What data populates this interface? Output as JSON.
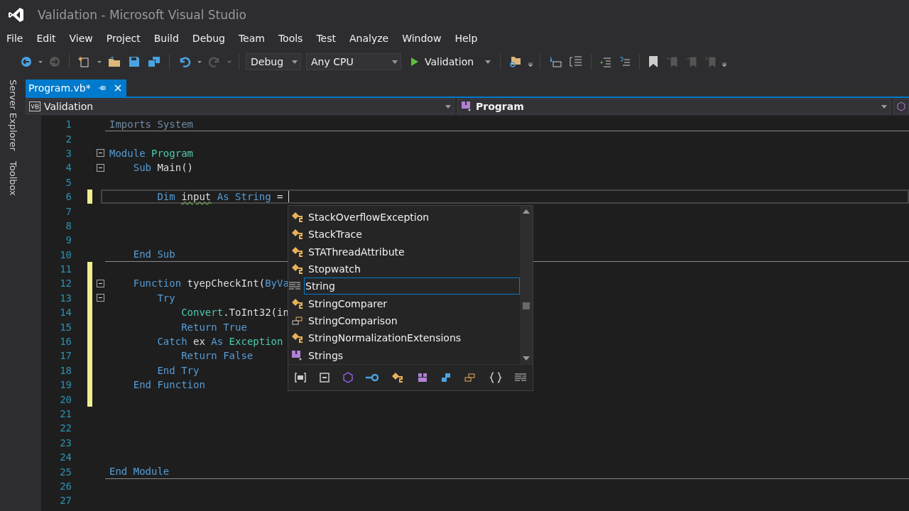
{
  "window": {
    "title": "Validation - Microsoft Visual Studio"
  },
  "menu": [
    "File",
    "Edit",
    "View",
    "Project",
    "Build",
    "Debug",
    "Team",
    "Tools",
    "Test",
    "Analyze",
    "Window",
    "Help"
  ],
  "toolbar": {
    "configuration": "Debug",
    "platform": "Any CPU",
    "start": "Validation"
  },
  "side_tabs": [
    "Server Explorer",
    "Toolbox"
  ],
  "tabs": [
    {
      "label": "Program.vb*",
      "selected": true
    }
  ],
  "navigation": {
    "project": "Validation",
    "type": "Program"
  },
  "lines": [
    {
      "number": "1",
      "tokens": [
        {
          "t": "Imports System",
          "kind": "faded"
        }
      ],
      "separator": true
    },
    {
      "number": "2"
    },
    {
      "number": "3",
      "fold": true,
      "tokens": [
        {
          "t": "Module ",
          "kind": "kw"
        },
        {
          "t": "Program",
          "kind": "type"
        }
      ]
    },
    {
      "number": "4",
      "fold": true,
      "tokens": [
        {
          "t": "    Sub",
          "kind": "kw"
        },
        {
          "t": " Main()",
          "kind": "plain"
        }
      ]
    },
    {
      "number": "5"
    },
    {
      "number": "6",
      "changed": true,
      "current": true,
      "tokens": [
        {
          "t": "        Dim ",
          "kind": "kw"
        },
        {
          "t": "input",
          "kind": "warn"
        },
        {
          "t": " As String",
          "kind": "kw"
        },
        {
          "t": " =",
          "kind": "plain"
        }
      ]
    },
    {
      "number": "7"
    },
    {
      "number": "8"
    },
    {
      "number": "9"
    },
    {
      "number": "10",
      "separator": true,
      "tokens": [
        {
          "t": "    End Sub",
          "kind": "kw"
        }
      ]
    },
    {
      "number": "11",
      "changed": true
    },
    {
      "number": "12",
      "changed": true,
      "fold": true,
      "tokens": [
        {
          "t": "    Function",
          "kind": "kw"
        },
        {
          "t": " tyepCheckInt(",
          "kind": "plain"
        },
        {
          "t": "ByVa",
          "kind": "kw"
        }
      ]
    },
    {
      "number": "13",
      "changed": true,
      "fold": true,
      "tokens": [
        {
          "t": "        Try",
          "kind": "kw"
        }
      ]
    },
    {
      "number": "14",
      "changed": true,
      "tokens": [
        {
          "t": "            Convert",
          "kind": "type"
        },
        {
          "t": ".ToInt32(in",
          "kind": "plain"
        }
      ]
    },
    {
      "number": "15",
      "changed": true,
      "tokens": [
        {
          "t": "            Return True",
          "kind": "kw"
        }
      ]
    },
    {
      "number": "16",
      "changed": true,
      "tokens": [
        {
          "t": "        Catch",
          "kind": "kw"
        },
        {
          "t": " ex ",
          "kind": "plain"
        },
        {
          "t": "As ",
          "kind": "kw"
        },
        {
          "t": "Exception",
          "kind": "type"
        }
      ]
    },
    {
      "number": "17",
      "changed": true,
      "tokens": [
        {
          "t": "            Return False",
          "kind": "kw"
        }
      ]
    },
    {
      "number": "18",
      "changed": true,
      "tokens": [
        {
          "t": "        End Try",
          "kind": "kw"
        }
      ]
    },
    {
      "number": "19",
      "changed": true,
      "tokens": [
        {
          "t": "    End Function",
          "kind": "kw"
        }
      ]
    },
    {
      "number": "20",
      "changed": true
    },
    {
      "number": "21"
    },
    {
      "number": "22"
    },
    {
      "number": "23"
    },
    {
      "number": "24"
    },
    {
      "number": "25",
      "separator": true,
      "tokens": [
        {
          "t": "End Module",
          "kind": "kw"
        }
      ]
    },
    {
      "number": "26"
    },
    {
      "number": "27"
    }
  ],
  "completion": {
    "items": [
      {
        "label": "StackOverflowException",
        "kind": "class",
        "selected": false
      },
      {
        "label": "StackTrace",
        "kind": "class",
        "selected": false
      },
      {
        "label": "STAThreadAttribute",
        "kind": "class",
        "selected": false
      },
      {
        "label": "Stopwatch",
        "kind": "class",
        "selected": false
      },
      {
        "label": "String",
        "kind": "keyword",
        "selected": true
      },
      {
        "label": "StringComparer",
        "kind": "class",
        "selected": false
      },
      {
        "label": "StringComparison",
        "kind": "enum",
        "selected": false
      },
      {
        "label": "StringNormalizationExtensions",
        "kind": "class",
        "selected": false
      },
      {
        "label": "Strings",
        "kind": "module",
        "selected": false
      }
    ],
    "filters": [
      {
        "kind": "namespace"
      },
      {
        "kind": "property"
      },
      {
        "kind": "method"
      },
      {
        "kind": "field"
      },
      {
        "kind": "class"
      },
      {
        "kind": "module"
      },
      {
        "kind": "interface"
      },
      {
        "kind": "enum"
      },
      {
        "kind": "braces"
      },
      {
        "kind": "keyword"
      }
    ]
  }
}
